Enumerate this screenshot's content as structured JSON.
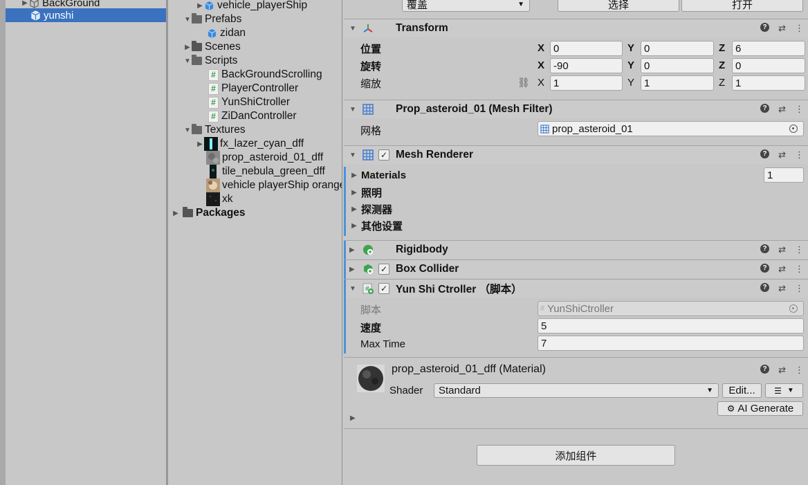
{
  "hierarchy": {
    "items": [
      {
        "label": "BackGround"
      },
      {
        "label": "yunshi"
      }
    ]
  },
  "project": {
    "items": [
      {
        "label": "vehicle_playerShip"
      },
      {
        "label": "Prefabs"
      },
      {
        "label": "zidan"
      },
      {
        "label": "Scenes"
      },
      {
        "label": "Scripts"
      },
      {
        "label": "BackGroundScrolling"
      },
      {
        "label": "PlayerController"
      },
      {
        "label": "YunShiCtroller"
      },
      {
        "label": "ZiDanController"
      },
      {
        "label": "Textures"
      },
      {
        "label": "fx_lazer_cyan_dff"
      },
      {
        "label": "prop_asteroid_01_dff"
      },
      {
        "label": "tile_nebula_green_dff"
      },
      {
        "label": "vehicle playerShip orange"
      },
      {
        "label": "xk"
      },
      {
        "label": "Packages"
      }
    ]
  },
  "inspector": {
    "top": {
      "override_label": "覆盖",
      "select_label": "选择",
      "open_label": "打开"
    },
    "transform": {
      "title": "Transform",
      "position_label": "位置",
      "rotation_label": "旋转",
      "scale_label": "缩放",
      "x": "X",
      "y": "Y",
      "z": "Z",
      "position": {
        "x": "0",
        "y": "0",
        "z": "6"
      },
      "rotation": {
        "x": "-90",
        "y": "0",
        "z": "0"
      },
      "scale": {
        "x": "1",
        "y": "1",
        "z": "1"
      }
    },
    "mesh_filter": {
      "title": "Prop_asteroid_01 (Mesh Filter)",
      "mesh_label": "网格",
      "mesh_value": "prop_asteroid_01"
    },
    "mesh_renderer": {
      "title": "Mesh Renderer",
      "materials_label": "Materials",
      "materials_count": "1",
      "lighting_label": "照明",
      "probes_label": "探测器",
      "other_label": "其他设置"
    },
    "rigidbody": {
      "title": "Rigidbody"
    },
    "box_collider": {
      "title": "Box Collider"
    },
    "script_comp": {
      "title": "Yun Shi Ctroller （脚本）",
      "script_label": "脚本",
      "script_value": "YunShiCtroller",
      "speed_label": "速度",
      "speed_value": "5",
      "maxtime_label": "Max Time",
      "maxtime_value": "7"
    },
    "material": {
      "title": "prop_asteroid_01_dff (Material)",
      "shader_label": "Shader",
      "shader_value": "Standard",
      "edit_label": "Edit...",
      "ai_label": "AI Generate"
    },
    "add_component_label": "添加组件"
  },
  "colors": {
    "selection": "#3a72c0",
    "accent_bar": "#4a94d8",
    "script_green": "#3aa04a"
  }
}
